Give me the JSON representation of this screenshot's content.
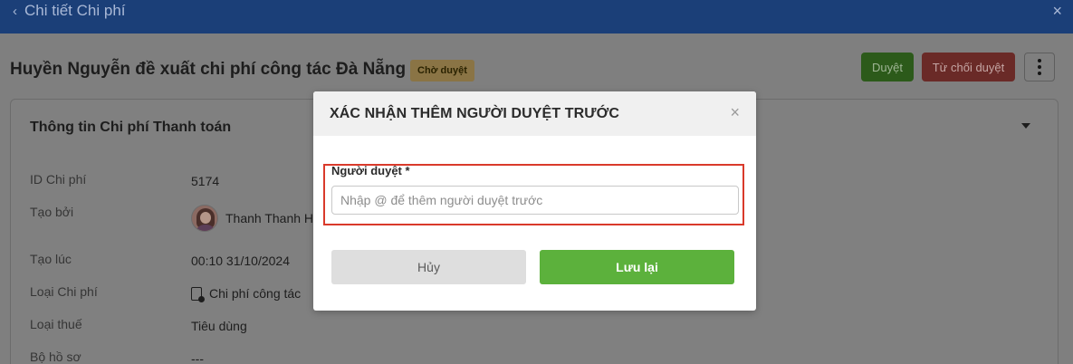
{
  "topbar": {
    "back_chevron": "‹",
    "back_label": "Chi tiết Chi phí",
    "close_glyph": "×"
  },
  "page": {
    "title": "Huyền Nguyễn đề xuất chi phí công tác Đà Nẵng",
    "status_badge": "Chờ duyệt",
    "approve_label": "Duyệt",
    "reject_label": "Từ chối duyệt"
  },
  "card": {
    "title": "Thông tin Chi phí Thanh toán",
    "rows": [
      {
        "label": "ID Chi phí",
        "value": "5174"
      },
      {
        "label": "Tạo bởi",
        "value": "Thanh Thanh H"
      },
      {
        "label": "Tạo lúc",
        "value": "00:10 31/10/2024"
      },
      {
        "label": "Loại Chi phí",
        "value": "Chi phí công tác"
      },
      {
        "label": "Loại thuế",
        "value": "Tiêu dùng"
      },
      {
        "label": "Bộ hồ sơ",
        "value": "---"
      }
    ]
  },
  "modal": {
    "title": "XÁC NHẬN THÊM NGƯỜI DUYỆT TRƯỚC",
    "close_glyph": "×",
    "field_label": "Người duyệt *",
    "field_placeholder": "Nhập @ để thêm người duyệt trước",
    "field_value": "",
    "cancel_label": "Hủy",
    "save_label": "Lưu lại"
  },
  "colors": {
    "topbar": "#1b3f78",
    "approve": "#2c5a1a",
    "reject": "#6a2a27",
    "save": "#5cb13c",
    "highlight": "#d93a2b"
  }
}
